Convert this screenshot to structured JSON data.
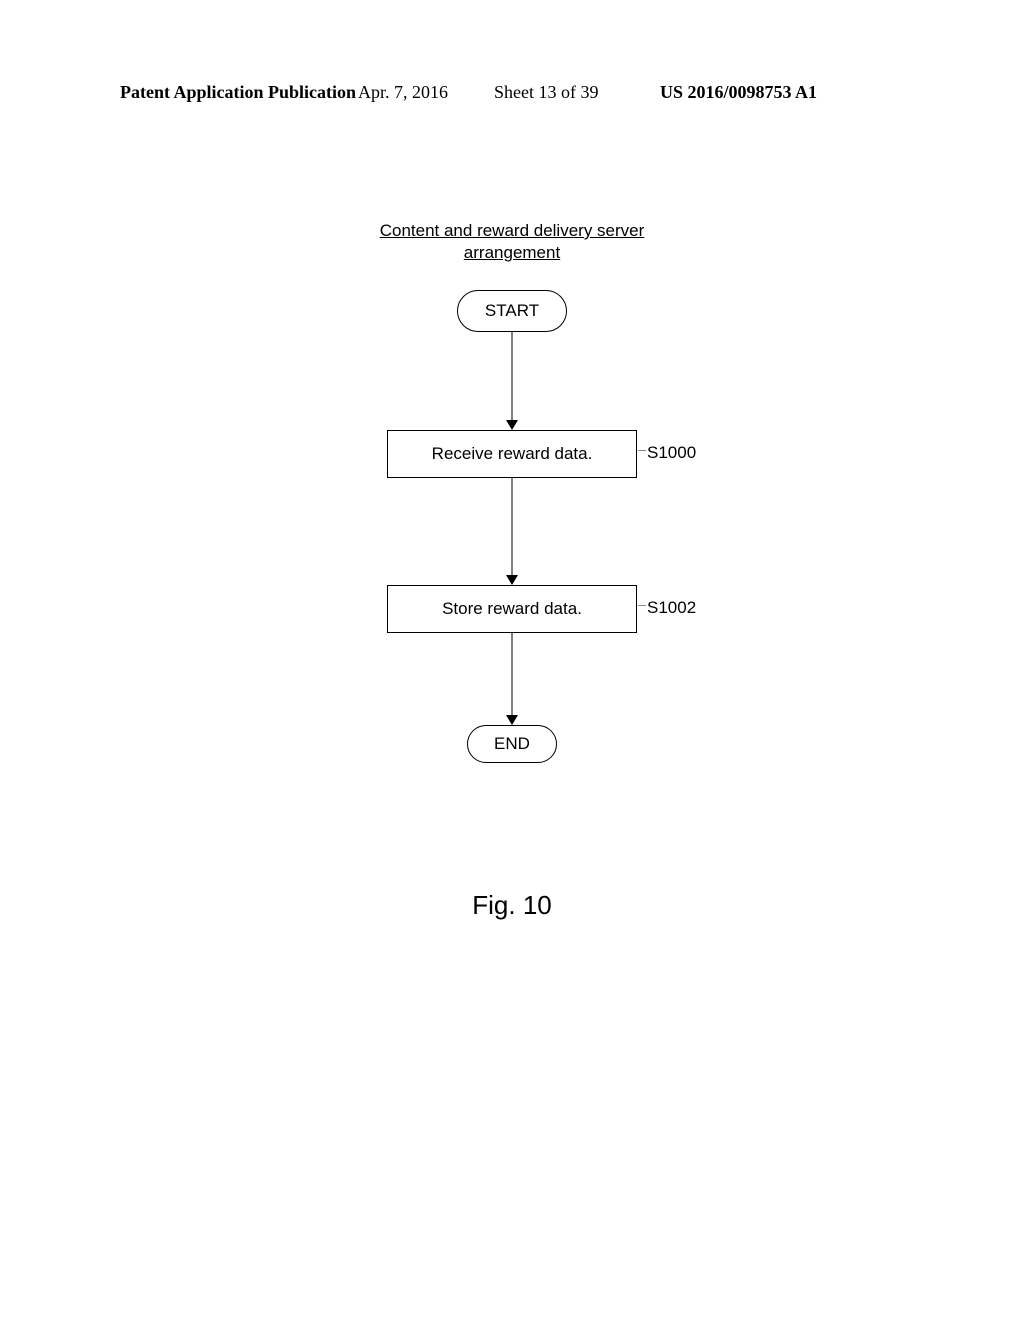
{
  "header": {
    "left": "Patent Application Publication",
    "date": "Apr. 7, 2016",
    "sheet": "Sheet 13 of 39",
    "right": "US 2016/0098753 A1"
  },
  "diagram": {
    "title_line1": "Content and reward delivery server",
    "title_line2": "arrangement",
    "start": "START",
    "end": "END",
    "steps": [
      {
        "text": "Receive reward data.",
        "label": "S1000"
      },
      {
        "text": "Store reward data.",
        "label": "S1002"
      }
    ]
  },
  "figure_caption": "Fig. 10",
  "chart_data": {
    "type": "flowchart",
    "title": "Content and reward delivery server arrangement",
    "nodes": [
      {
        "id": "start",
        "type": "terminal",
        "text": "START"
      },
      {
        "id": "s1000",
        "type": "process",
        "text": "Receive reward data.",
        "label": "S1000"
      },
      {
        "id": "s1002",
        "type": "process",
        "text": "Store reward data.",
        "label": "S1002"
      },
      {
        "id": "end",
        "type": "terminal",
        "text": "END"
      }
    ],
    "edges": [
      {
        "from": "start",
        "to": "s1000"
      },
      {
        "from": "s1000",
        "to": "s1002"
      },
      {
        "from": "s1002",
        "to": "end"
      }
    ]
  }
}
